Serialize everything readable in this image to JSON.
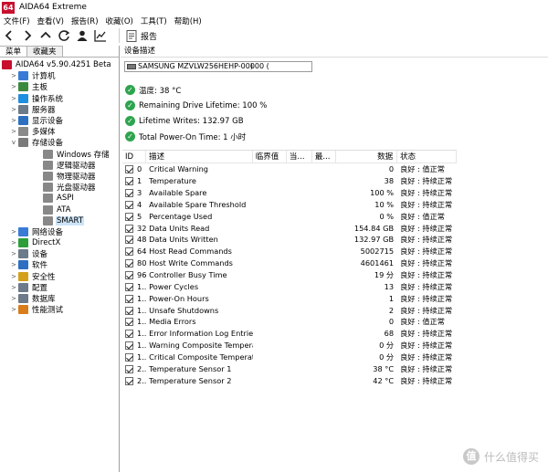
{
  "window": {
    "logo": "64",
    "title": "AIDA64 Extreme"
  },
  "menu": [
    "文件(F)",
    "查看(V)",
    "报告(R)",
    "收藏(O)",
    "工具(T)",
    "帮助(H)"
  ],
  "toolbar": {
    "report_label": "报告"
  },
  "panel_tabs": [
    "菜单",
    "收藏夹"
  ],
  "tree": [
    {
      "label": "AIDA64 v5.90.4251 Beta",
      "indent": 0,
      "expander": "",
      "icon": "aida-icon",
      "color": "#c8102e"
    },
    {
      "label": "计算机",
      "indent": 1,
      "expander": ">",
      "icon": "computer-icon",
      "color": "#3a7bd5"
    },
    {
      "label": "主板",
      "indent": 1,
      "expander": ">",
      "icon": "motherboard-icon",
      "color": "#3b8a3e"
    },
    {
      "label": "操作系统",
      "indent": 1,
      "expander": ">",
      "icon": "windows-icon",
      "color": "#1f8fe0"
    },
    {
      "label": "服务器",
      "indent": 1,
      "expander": ">",
      "icon": "server-icon",
      "color": "#6c7a89"
    },
    {
      "label": "显示设备",
      "indent": 1,
      "expander": ">",
      "icon": "display-icon",
      "color": "#2d6fc1"
    },
    {
      "label": "多媒体",
      "indent": 1,
      "expander": ">",
      "icon": "multimedia-icon",
      "color": "#8a8a8a"
    },
    {
      "label": "存储设备",
      "indent": 1,
      "expander": "v",
      "icon": "storage-icon",
      "color": "#7b7b7b"
    },
    {
      "label": "Windows 存储",
      "indent": 2,
      "expander": "",
      "icon": "disk-icon",
      "color": "#888"
    },
    {
      "label": "逻辑驱动器",
      "indent": 2,
      "expander": "",
      "icon": "disk-icon",
      "color": "#888"
    },
    {
      "label": "物理驱动器",
      "indent": 2,
      "expander": "",
      "icon": "disk-icon",
      "color": "#888"
    },
    {
      "label": "光盘驱动器",
      "indent": 2,
      "expander": "",
      "icon": "disk-icon",
      "color": "#888"
    },
    {
      "label": "ASPI",
      "indent": 2,
      "expander": "",
      "icon": "disk-icon",
      "color": "#888"
    },
    {
      "label": "ATA",
      "indent": 2,
      "expander": "",
      "icon": "disk-icon",
      "color": "#888"
    },
    {
      "label": "SMART",
      "indent": 2,
      "expander": "",
      "icon": "smart-icon",
      "color": "#888",
      "selected": true
    },
    {
      "label": "网络设备",
      "indent": 1,
      "expander": ">",
      "icon": "network-icon",
      "color": "#3a7bd5"
    },
    {
      "label": "DirectX",
      "indent": 1,
      "expander": ">",
      "icon": "directx-icon",
      "color": "#2e9e3a"
    },
    {
      "label": "设备",
      "indent": 1,
      "expander": ">",
      "icon": "devices-icon",
      "color": "#6c7a89"
    },
    {
      "label": "软件",
      "indent": 1,
      "expander": ">",
      "icon": "software-icon",
      "color": "#2d6fc1"
    },
    {
      "label": "安全性",
      "indent": 1,
      "expander": ">",
      "icon": "shield-icon",
      "color": "#d4a017"
    },
    {
      "label": "配置",
      "indent": 1,
      "expander": ">",
      "icon": "config-icon",
      "color": "#6c7a89"
    },
    {
      "label": "数据库",
      "indent": 1,
      "expander": ">",
      "icon": "database-icon",
      "color": "#6c7a89"
    },
    {
      "label": "性能测试",
      "indent": 1,
      "expander": ">",
      "icon": "benchmark-icon",
      "color": "#d97c1a"
    }
  ],
  "device": {
    "header": "设备描述",
    "name": "SAMSUNG MZVLW256HEHP-00000 (",
    "name_end": ")"
  },
  "status": [
    "温度: 38 °C",
    "Remaining Drive Lifetime: 100 %",
    "Lifetime Writes: 132.97 GB",
    "Total Power-On Time: 1 小时"
  ],
  "table": {
    "columns": [
      "ID",
      "描述",
      "临界值",
      "当...",
      "最...",
      "数据",
      "状态"
    ],
    "rows": [
      {
        "id": "0",
        "desc": "Critical Warning",
        "data": "0",
        "status": "良好 : 值正常"
      },
      {
        "id": "1",
        "desc": "Temperature",
        "data": "38",
        "status": "良好 : 持续正常"
      },
      {
        "id": "3",
        "desc": "Available Spare",
        "data": "100 %",
        "status": "良好 : 持续正常"
      },
      {
        "id": "4",
        "desc": "Available Spare Threshold",
        "data": "10 %",
        "status": "良好 : 持续正常"
      },
      {
        "id": "5",
        "desc": "Percentage Used",
        "data": "0 %",
        "status": "良好 : 值正常"
      },
      {
        "id": "32",
        "desc": "Data Units Read",
        "data": "154.84 GB",
        "status": "良好 : 持续正常"
      },
      {
        "id": "48",
        "desc": "Data Units Written",
        "data": "132.97 GB",
        "status": "良好 : 持续正常"
      },
      {
        "id": "64",
        "desc": "Host Read Commands",
        "data": "5002715",
        "status": "良好 : 持续正常"
      },
      {
        "id": "80",
        "desc": "Host Write Commands",
        "data": "4601461",
        "status": "良好 : 持续正常"
      },
      {
        "id": "96",
        "desc": "Controller Busy Time",
        "data": "19 分",
        "status": "良好 : 持续正常"
      },
      {
        "id": "1...",
        "desc": "Power Cycles",
        "data": "13",
        "status": "良好 : 持续正常"
      },
      {
        "id": "1...",
        "desc": "Power-On Hours",
        "data": "1",
        "status": "良好 : 持续正常"
      },
      {
        "id": "1...",
        "desc": "Unsafe Shutdowns",
        "data": "2",
        "status": "良好 : 持续正常"
      },
      {
        "id": "1...",
        "desc": "Media Errors",
        "data": "0",
        "status": "良好 : 值正常"
      },
      {
        "id": "1...",
        "desc": "Error Information Log Entries",
        "data": "68",
        "status": "良好 : 持续正常"
      },
      {
        "id": "1...",
        "desc": "Warning Composite Temperatu...",
        "data": "0 分",
        "status": "良好 : 持续正常"
      },
      {
        "id": "1...",
        "desc": "Critical Composite Temperatur...",
        "data": "0 分",
        "status": "良好 : 持续正常"
      },
      {
        "id": "2...",
        "desc": "Temperature Sensor 1",
        "data": "38 °C",
        "status": "良好 : 持续正常"
      },
      {
        "id": "2...",
        "desc": "Temperature Sensor 2",
        "data": "42 °C",
        "status": "良好 : 持续正常"
      }
    ]
  },
  "watermark": {
    "logo": "值",
    "text": "什么值得买"
  }
}
